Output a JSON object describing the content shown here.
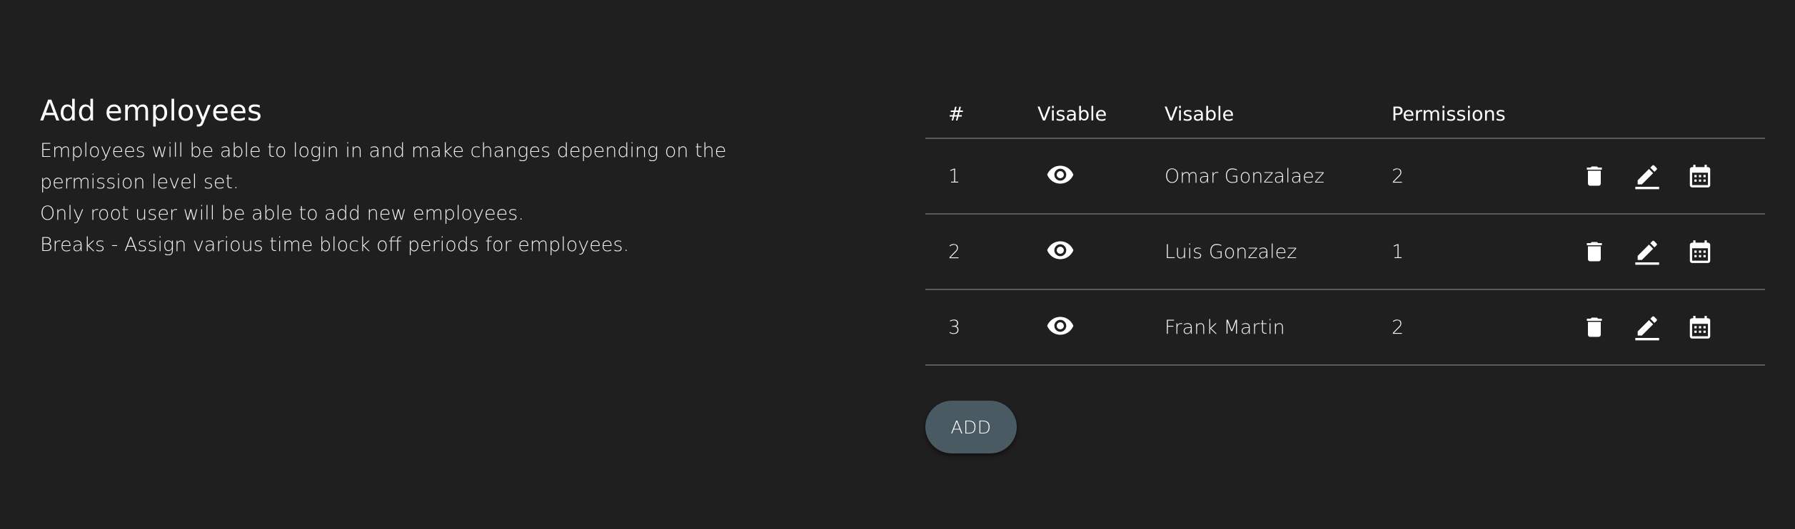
{
  "info": {
    "title": "Add employees",
    "lines": [
      "Employees will be able to login in and make changes depending on the",
      "permission level set.",
      "Only root user will be able to add new employees.",
      "Breaks - Assign various time block off periods for employees."
    ]
  },
  "table": {
    "headers": {
      "num": "#",
      "visible": "Visable",
      "name": "Visable",
      "permissions": "Permissions"
    },
    "rows": [
      {
        "num": "1",
        "name": "Omar Gonzalaez",
        "permissions": "2"
      },
      {
        "num": "2",
        "name": "Luis Gonzalez",
        "permissions": "1"
      },
      {
        "num": "3",
        "name": "Frank Martin",
        "permissions": "2"
      }
    ]
  },
  "icons": {
    "visible": "eye-icon",
    "delete": "trash-icon",
    "edit": "pencil-icon",
    "breaks": "calendar-icon"
  },
  "buttons": {
    "add_label": "ADD"
  },
  "colors": {
    "background": "#1f1f1f",
    "divider": "#5a5a5a",
    "add_button": "#4a5a63",
    "text": "#ffffff"
  }
}
